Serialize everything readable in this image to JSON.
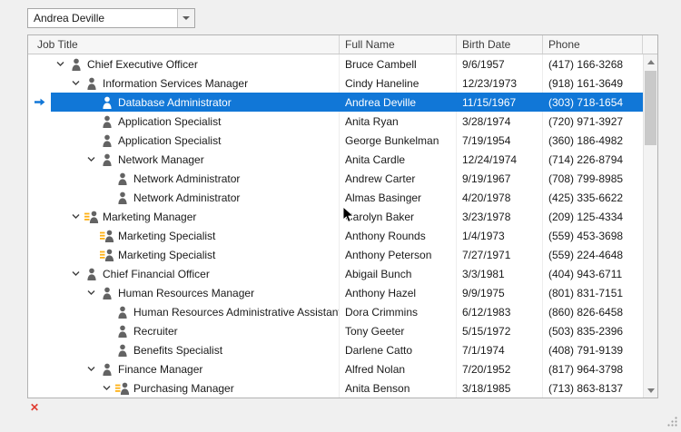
{
  "lookup": {
    "value": "Andrea Deville"
  },
  "treelist": {
    "columns": [
      {
        "key": "job",
        "label": "Job Title"
      },
      {
        "key": "name",
        "label": "Full Name"
      },
      {
        "key": "birth",
        "label": "Birth Date"
      },
      {
        "key": "phone",
        "label": "Phone"
      }
    ],
    "rows": [
      {
        "level": 0,
        "expanded": true,
        "icon": "person",
        "selected": false,
        "job": "Chief Executive Officer",
        "name": "Bruce Cambell",
        "birth": "9/6/1957",
        "phone": "(417) 166-3268"
      },
      {
        "level": 1,
        "expanded": true,
        "icon": "person",
        "selected": false,
        "job": "Information Services Manager",
        "name": "Cindy Haneline",
        "birth": "12/23/1973",
        "phone": "(918) 161-3649"
      },
      {
        "level": 2,
        "expanded": false,
        "icon": "person",
        "selected": true,
        "job": "Database Administrator",
        "name": "Andrea Deville",
        "birth": "11/15/1967",
        "phone": "(303) 718-1654"
      },
      {
        "level": 2,
        "expanded": false,
        "icon": "person",
        "selected": false,
        "job": "Application Specialist",
        "name": "Anita Ryan",
        "birth": "3/28/1974",
        "phone": "(720) 971-3927"
      },
      {
        "level": 2,
        "expanded": false,
        "icon": "person",
        "selected": false,
        "job": "Application Specialist",
        "name": "George Bunkelman",
        "birth": "7/19/1954",
        "phone": "(360) 186-4982"
      },
      {
        "level": 2,
        "expanded": true,
        "icon": "person",
        "selected": false,
        "job": "Network Manager",
        "name": "Anita Cardle",
        "birth": "12/24/1974",
        "phone": "(714) 226-8794"
      },
      {
        "level": 3,
        "expanded": false,
        "icon": "person",
        "selected": false,
        "job": "Network Administrator",
        "name": "Andrew Carter",
        "birth": "9/19/1967",
        "phone": "(708) 799-8985"
      },
      {
        "level": 3,
        "expanded": false,
        "icon": "person",
        "selected": false,
        "job": "Network Administrator",
        "name": "Almas Basinger",
        "birth": "4/20/1978",
        "phone": "(425) 335-6622"
      },
      {
        "level": 1,
        "expanded": true,
        "icon": "person-tasks",
        "selected": false,
        "job": "Marketing Manager",
        "name": "Carolyn Baker",
        "birth": "3/23/1978",
        "phone": "(209) 125-4334"
      },
      {
        "level": 2,
        "expanded": false,
        "icon": "person-tasks",
        "selected": false,
        "job": "Marketing Specialist",
        "name": "Anthony Rounds",
        "birth": "1/4/1973",
        "phone": "(559) 453-3698"
      },
      {
        "level": 2,
        "expanded": false,
        "icon": "person-tasks",
        "selected": false,
        "job": "Marketing Specialist",
        "name": "Anthony Peterson",
        "birth": "7/27/1971",
        "phone": "(559) 224-4648"
      },
      {
        "level": 1,
        "expanded": true,
        "icon": "person",
        "selected": false,
        "job": "Chief Financial Officer",
        "name": "Abigail Bunch",
        "birth": "3/3/1981",
        "phone": "(404) 943-6711"
      },
      {
        "level": 2,
        "expanded": true,
        "icon": "person",
        "selected": false,
        "job": "Human Resources Manager",
        "name": "Anthony Hazel",
        "birth": "9/9/1975",
        "phone": "(801) 831-7151"
      },
      {
        "level": 3,
        "expanded": false,
        "icon": "person",
        "selected": false,
        "job": "Human Resources Administrative Assistant",
        "name": "Dora Crimmins",
        "birth": "6/12/1983",
        "phone": "(860) 826-6458"
      },
      {
        "level": 3,
        "expanded": false,
        "icon": "person",
        "selected": false,
        "job": "Recruiter",
        "name": "Tony Geeter",
        "birth": "5/15/1972",
        "phone": "(503) 835-2396"
      },
      {
        "level": 3,
        "expanded": false,
        "icon": "person",
        "selected": false,
        "job": "Benefits Specialist",
        "name": "Darlene Catto",
        "birth": "7/1/1974",
        "phone": "(408) 791-9139"
      },
      {
        "level": 2,
        "expanded": true,
        "icon": "person",
        "selected": false,
        "job": "Finance Manager",
        "name": "Alfred Nolan",
        "birth": "7/20/1952",
        "phone": "(817) 964-3798"
      },
      {
        "level": 3,
        "expanded": true,
        "icon": "person-tasks",
        "selected": false,
        "job": "Purchasing Manager",
        "name": "Anita Benson",
        "birth": "3/18/1985",
        "phone": "(713) 863-8137"
      }
    ]
  },
  "statusbar": {
    "error_glyph": "✕"
  },
  "colors": {
    "selection": "#1177d7",
    "icon_gray": "#636363",
    "icon_orange": "#ffb115",
    "selected_text": "#ffffff"
  }
}
